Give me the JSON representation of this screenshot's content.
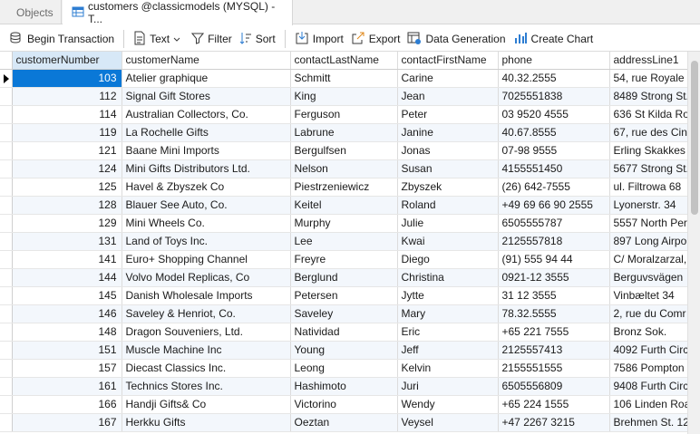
{
  "tabs": [
    {
      "label": "Objects"
    },
    {
      "label": "customers @classicmodels (MYSQL) - T..."
    }
  ],
  "toolbar": {
    "begin_transaction": "Begin Transaction",
    "text": "Text",
    "filter": "Filter",
    "sort": "Sort",
    "import": "Import",
    "export": "Export",
    "data_generation": "Data Generation",
    "create_chart": "Create Chart"
  },
  "grid": {
    "columns": [
      "customerNumber",
      "customerName",
      "contactLastName",
      "contactFirstName",
      "phone",
      "addressLine1"
    ],
    "rows": [
      [
        "103",
        "Atelier graphique",
        "Schmitt",
        "Carine",
        "40.32.2555",
        "54, rue Royale"
      ],
      [
        "112",
        "Signal Gift Stores",
        "King",
        "Jean",
        "7025551838",
        "8489 Strong St."
      ],
      [
        "114",
        "Australian Collectors, Co.",
        "Ferguson",
        "Peter",
        "03 9520 4555",
        "636 St Kilda Ro"
      ],
      [
        "119",
        "La Rochelle Gifts",
        "Labrune",
        "Janine",
        "40.67.8555",
        "67, rue des Cin"
      ],
      [
        "121",
        "Baane Mini Imports",
        "Bergulfsen",
        "Jonas",
        "07-98 9555",
        "Erling Skakkes"
      ],
      [
        "124",
        "Mini Gifts Distributors Ltd.",
        "Nelson",
        "Susan",
        "4155551450",
        "5677 Strong St."
      ],
      [
        "125",
        "Havel & Zbyszek Co",
        "Piestrzeniewicz",
        "Zbyszek",
        "(26) 642-7555",
        "ul. Filtrowa 68"
      ],
      [
        "128",
        "Blauer See Auto, Co.",
        "Keitel",
        "Roland",
        "+49 69 66 90 2555",
        "Lyonerstr. 34"
      ],
      [
        "129",
        "Mini Wheels Co.",
        "Murphy",
        "Julie",
        "6505555787",
        "5557 North Per"
      ],
      [
        "131",
        "Land of Toys Inc.",
        "Lee",
        "Kwai",
        "2125557818",
        "897 Long Airpo"
      ],
      [
        "141",
        "Euro+ Shopping Channel",
        "Freyre",
        "Diego",
        "(91) 555 94 44",
        "C/ Moralzarzal,"
      ],
      [
        "144",
        "Volvo Model Replicas, Co",
        "Berglund",
        "Christina",
        "0921-12 3555",
        "Berguvsvägen"
      ],
      [
        "145",
        "Danish Wholesale Imports",
        "Petersen",
        "Jytte",
        "31 12 3555",
        "Vinbæltet 34"
      ],
      [
        "146",
        "Saveley & Henriot, Co.",
        "Saveley",
        "Mary",
        "78.32.5555",
        "2, rue du Comr"
      ],
      [
        "148",
        "Dragon Souveniers, Ltd.",
        "Natividad",
        "Eric",
        "+65 221 7555",
        "Bronz Sok."
      ],
      [
        "151",
        "Muscle Machine Inc",
        "Young",
        "Jeff",
        "2125557413",
        "4092 Furth Circ"
      ],
      [
        "157",
        "Diecast Classics Inc.",
        "Leong",
        "Kelvin",
        "2155551555",
        "7586 Pompton"
      ],
      [
        "161",
        "Technics Stores Inc.",
        "Hashimoto",
        "Juri",
        "6505556809",
        "9408 Furth Circ"
      ],
      [
        "166",
        "Handji Gifts& Co",
        "Victorino",
        "Wendy",
        "+65 224 1555",
        "106 Linden Roa"
      ],
      [
        "167",
        "Herkku Gifts",
        "Oeztan",
        "Veysel",
        "+47 2267 3215",
        "Brehmen St. 12"
      ]
    ]
  }
}
